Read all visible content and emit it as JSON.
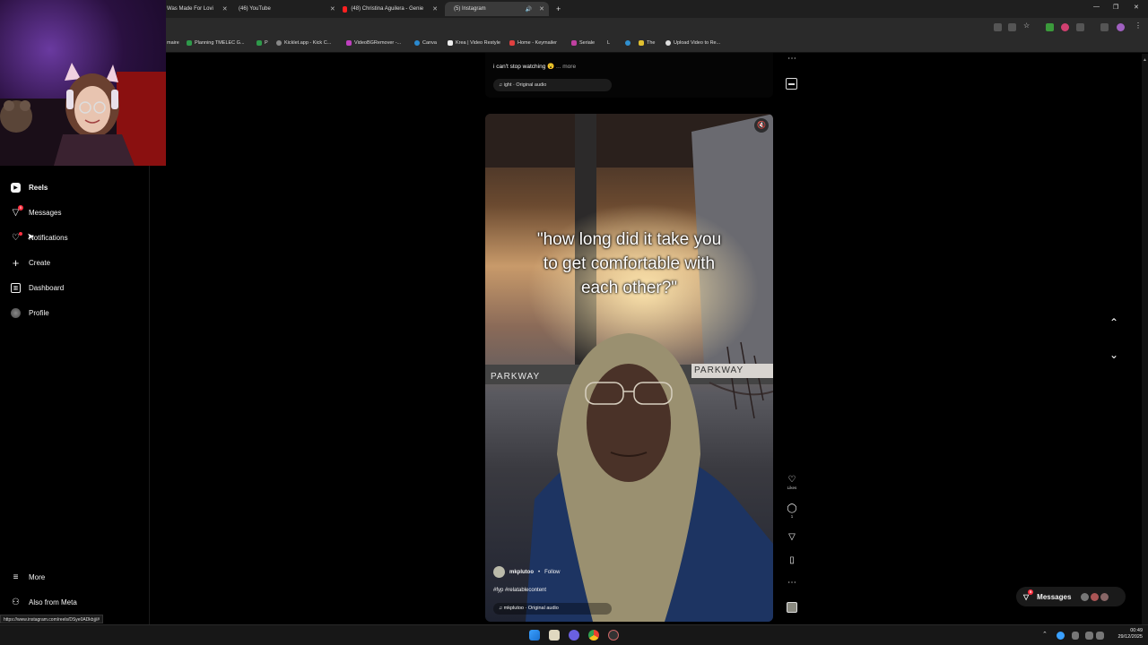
{
  "browser": {
    "tabs": [
      {
        "label": "Was Made For Lovi"
      },
      {
        "label": "(46) YouTube"
      },
      {
        "label": "(48) Christina Aguilera - Genie"
      },
      {
        "label": "(5) Instagram"
      }
    ],
    "new_tab": "+",
    "bookmarks": [
      {
        "label": "maire"
      },
      {
        "label": "Planning TMELEC G..."
      },
      {
        "label": "P"
      },
      {
        "label": "Kicklet.app - Kick C..."
      },
      {
        "label": "VideoBGRemover -..."
      },
      {
        "label": "Canva"
      },
      {
        "label": "Krea | Video Restyle"
      },
      {
        "label": "Home - Keymailer"
      },
      {
        "label": "Seriale"
      },
      {
        "label": "L"
      },
      {
        "label": "The"
      },
      {
        "label": "Upload Video to Re..."
      }
    ],
    "status_url": "https://www.instagram.com/reels/DSye0ADkbjj/#"
  },
  "sidebar": {
    "items": [
      {
        "label": "Reels",
        "icon": "reels-icon"
      },
      {
        "label": "Messages",
        "icon": "messages-icon",
        "badge": "5"
      },
      {
        "label": "Notifications",
        "icon": "heart-icon"
      },
      {
        "label": "Create",
        "icon": "plus-icon"
      },
      {
        "label": "Dashboard",
        "icon": "dashboard-icon"
      },
      {
        "label": "Profile",
        "icon": "avatar"
      }
    ],
    "more": "More",
    "also_from_meta": "Also from Meta"
  },
  "previous_reel": {
    "caption": "i can't stop watching 😮",
    "more": "... more",
    "audio": "ight · Original audio"
  },
  "reel": {
    "overlay_lines": [
      "\"how long did it take you",
      "to get comfortable with",
      "each other?\""
    ],
    "sign_left": "PARKWAY",
    "sign_right": "PARKWAY",
    "username": "mkplutoo",
    "separator": "•",
    "follow": "Follow",
    "caption": "#fyp #relatablecontent",
    "audio": "mkplutoo · Original audio",
    "likes_label": "Likes",
    "comments_count": "1"
  },
  "messages_pill": {
    "label": "Messages",
    "badge": "5"
  },
  "clock": {
    "time": "00:49",
    "date": "29/12/2025"
  },
  "colors": {
    "accent_red": "#ff3040",
    "background": "#000000"
  }
}
